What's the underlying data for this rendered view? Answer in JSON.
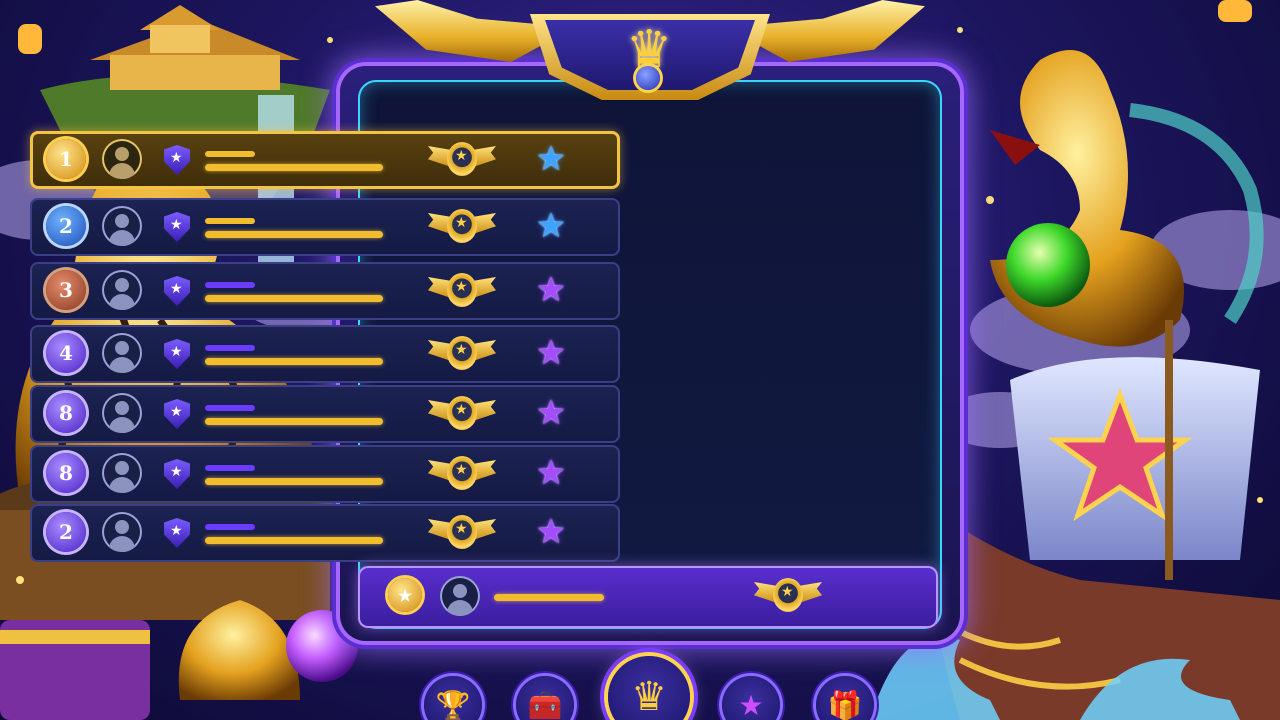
{
  "leaderboard": {
    "rows": [
      {
        "rank": "1",
        "medal": "gold",
        "badge_color": "blue",
        "highlight": true
      },
      {
        "rank": "2",
        "medal": "silver",
        "badge_color": "blue",
        "highlight": false
      },
      {
        "rank": "3",
        "medal": "bronze",
        "badge_color": "violet",
        "highlight": false
      },
      {
        "rank": "4",
        "medal": "purple",
        "badge_color": "violet",
        "highlight": false
      },
      {
        "rank": "8",
        "medal": "purple",
        "badge_color": "violet",
        "highlight": false
      },
      {
        "rank": "8",
        "medal": "purple",
        "badge_color": "violet",
        "highlight": false
      },
      {
        "rank": "2",
        "medal": "purple",
        "badge_color": "violet",
        "highlight": false
      }
    ],
    "self_row": {
      "medal": "gold"
    }
  },
  "nav": {
    "items": [
      {
        "icon": "trophy-icon",
        "glyph": "🏆"
      },
      {
        "icon": "treasure-chest-icon",
        "glyph": "🧰"
      },
      {
        "icon": "crown-icon",
        "glyph": "♛",
        "active": true
      },
      {
        "icon": "star-icon",
        "glyph": "★"
      },
      {
        "icon": "gift-icon",
        "glyph": "🎁"
      }
    ]
  },
  "header": {
    "icon": "crown-icon",
    "glyph": "♛"
  },
  "colors": {
    "gold": "#f2bd2c",
    "violet": "#6b3cff",
    "frame_glow": "#a766ff",
    "cyan_edge": "#3bd6ff"
  }
}
